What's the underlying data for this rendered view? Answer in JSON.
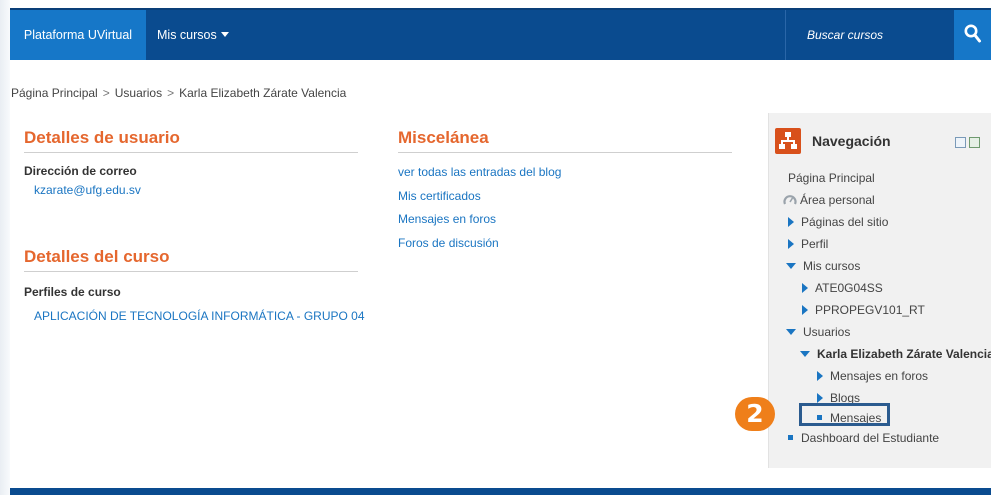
{
  "navbar": {
    "brand": "Plataforma UVirtual",
    "menu_label": "Mis cursos",
    "search_placeholder": "Buscar cursos"
  },
  "breadcrumb": {
    "items": [
      "Página Principal",
      "Usuarios",
      "Karla Elizabeth Zárate Valencia"
    ],
    "separator": ">"
  },
  "user_details": {
    "title": "Detalles de usuario",
    "email_label": "Dirección de correo",
    "email_value": "kzarate@ufg.edu.sv"
  },
  "course_details": {
    "title": "Detalles del curso",
    "profiles_label": "Perfiles de curso",
    "course_link": "APLICACIÓN DE TECNOLOGÍA INFORMÁTICA - GRUPO 04"
  },
  "misc": {
    "title": "Miscelánea",
    "links": [
      "ver todas las entradas del blog",
      "Mis certificados",
      "Mensajes en foros",
      "Foros de discusión"
    ]
  },
  "navigation": {
    "title": "Navegación",
    "items": [
      {
        "label": "Página Principal",
        "icon": "none"
      },
      {
        "label": "Área personal",
        "icon": "dashboard-icon"
      },
      {
        "label": "Páginas del sitio",
        "icon": "triangle-right"
      },
      {
        "label": "Perfil",
        "icon": "triangle-right"
      },
      {
        "label": "Mis cursos",
        "icon": "triangle-down"
      },
      {
        "label": "ATE0G04SS",
        "icon": "triangle-right"
      },
      {
        "label": "PPROPEGV101_RT",
        "icon": "triangle-right"
      },
      {
        "label": "Usuarios",
        "icon": "triangle-down"
      },
      {
        "label": "Karla Elizabeth Zárate Valencia",
        "icon": "triangle-down"
      },
      {
        "label": "Mensajes en foros",
        "icon": "triangle-right"
      },
      {
        "label": "Blogs",
        "icon": "triangle-right"
      },
      {
        "label": "Mensajes",
        "icon": "square"
      },
      {
        "label": "Dashboard del Estudiante",
        "icon": "square"
      }
    ]
  },
  "annotation": {
    "step_number": "2"
  },
  "colors": {
    "navbar_bg": "#0a4b8f",
    "accent_blue": "#1677c8",
    "heading_orange": "#e5672e",
    "link_blue": "#1a75c2",
    "badge_orange": "#ef7f1a",
    "highlight_border": "#2b5b8f"
  }
}
